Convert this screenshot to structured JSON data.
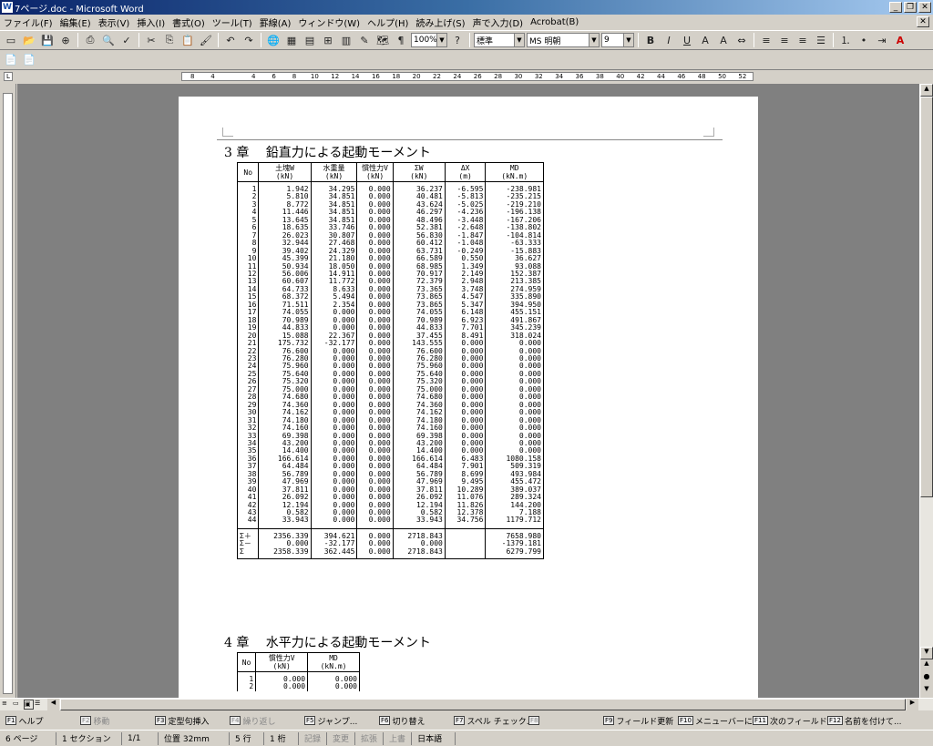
{
  "window": {
    "title": "7ページ.doc - Microsoft Word"
  },
  "menu": [
    "ファイル(F)",
    "編集(E)",
    "表示(V)",
    "挿入(I)",
    "書式(O)",
    "ツール(T)",
    "罫線(A)",
    "ウィンドウ(W)",
    "ヘルプ(H)",
    "読み上げ(S)",
    "声で入力(D)",
    "Acrobat(B)"
  ],
  "toolbar": {
    "zoom": "100%",
    "style": "標準",
    "font": "MS 明朝",
    "size": "9"
  },
  "ruler": [
    "8",
    "4",
    "",
    "4",
    "6",
    "8",
    "10",
    "12",
    "14",
    "16",
    "18",
    "20",
    "22",
    "24",
    "26",
    "28",
    "30",
    "32",
    "34",
    "36",
    "38",
    "40",
    "42",
    "44",
    "46",
    "48",
    "50",
    "52"
  ],
  "doc": {
    "heading3": "3 章　 鉛直力による起動モーメント",
    "heading4": "4 章　 水平力による起動モーメント",
    "table3": {
      "headers": [
        [
          "No",
          ""
        ],
        [
          "土塊W",
          "(kN)"
        ],
        [
          "水重量",
          "(kN)"
        ],
        [
          "慣性力V",
          "(kN)"
        ],
        [
          "ΣW",
          "(kN)"
        ],
        [
          "ΔX",
          "(m)"
        ],
        [
          "MD",
          "(kN.m)"
        ]
      ],
      "rows": [
        [
          "1",
          "1.942",
          "34.295",
          "0.000",
          "36.237",
          "-6.595",
          "-238.981"
        ],
        [
          "2",
          "5.810",
          "34.851",
          "0.000",
          "40.481",
          "-5.813",
          "-235.215"
        ],
        [
          "3",
          "8.772",
          "34.851",
          "0.000",
          "43.624",
          "-5.025",
          "-219.210"
        ],
        [
          "4",
          "11.446",
          "34.851",
          "0.000",
          "46.297",
          "-4.236",
          "-196.138"
        ],
        [
          "5",
          "13.645",
          "34.851",
          "0.000",
          "48.496",
          "-3.448",
          "-167.206"
        ],
        [
          "6",
          "18.635",
          "33.746",
          "0.000",
          "52.381",
          "-2.648",
          "-138.802"
        ],
        [
          "7",
          "26.023",
          "30.807",
          "0.000",
          "56.830",
          "-1.847",
          "-104.814"
        ],
        [
          "8",
          "32.944",
          "27.468",
          "0.000",
          "60.412",
          "-1.048",
          "-63.333"
        ],
        [
          "9",
          "39.402",
          "24.329",
          "0.000",
          "63.731",
          "-0.249",
          "-15.883"
        ],
        [
          "10",
          "45.399",
          "21.180",
          "0.000",
          "66.589",
          "0.550",
          "36.627"
        ],
        [
          "11",
          "50.934",
          "18.050",
          "0.000",
          "68.985",
          "1.349",
          "93.088"
        ],
        [
          "12",
          "56.006",
          "14.911",
          "0.000",
          "70.917",
          "2.149",
          "152.387"
        ],
        [
          "13",
          "60.607",
          "11.772",
          "0.000",
          "72.379",
          "2.948",
          "213.385"
        ],
        [
          "14",
          "64.733",
          "8.633",
          "0.000",
          "73.365",
          "3.748",
          "274.959"
        ],
        [
          "15",
          "68.372",
          "5.494",
          "0.000",
          "73.865",
          "4.547",
          "335.890"
        ],
        [
          "16",
          "71.511",
          "2.354",
          "0.000",
          "73.865",
          "5.347",
          "394.950"
        ],
        [
          "17",
          "74.055",
          "0.000",
          "0.000",
          "74.055",
          "6.148",
          "455.151"
        ],
        [
          "18",
          "70.989",
          "0.000",
          "0.000",
          "70.989",
          "6.923",
          "491.867"
        ],
        [
          "19",
          "44.833",
          "0.000",
          "0.000",
          "44.833",
          "7.701",
          "345.239"
        ],
        [
          "20",
          "15.088",
          "22.367",
          "0.000",
          "37.455",
          "8.491",
          "318.024"
        ],
        [
          "21",
          "175.732",
          "-32.177",
          "0.000",
          "143.555",
          "0.000",
          "0.000"
        ],
        [
          "22",
          "76.600",
          "0.000",
          "0.000",
          "76.600",
          "0.000",
          "0.000"
        ],
        [
          "23",
          "76.280",
          "0.000",
          "0.000",
          "76.280",
          "0.000",
          "0.000"
        ],
        [
          "24",
          "75.960",
          "0.000",
          "0.000",
          "75.960",
          "0.000",
          "0.000"
        ],
        [
          "25",
          "75.640",
          "0.000",
          "0.000",
          "75.640",
          "0.000",
          "0.000"
        ],
        [
          "26",
          "75.320",
          "0.000",
          "0.000",
          "75.320",
          "0.000",
          "0.000"
        ],
        [
          "27",
          "75.000",
          "0.000",
          "0.000",
          "75.000",
          "0.000",
          "0.000"
        ],
        [
          "28",
          "74.680",
          "0.000",
          "0.000",
          "74.680",
          "0.000",
          "0.000"
        ],
        [
          "29",
          "74.360",
          "0.000",
          "0.000",
          "74.360",
          "0.000",
          "0.000"
        ],
        [
          "30",
          "74.162",
          "0.000",
          "0.000",
          "74.162",
          "0.000",
          "0.000"
        ],
        [
          "31",
          "74.180",
          "0.000",
          "0.000",
          "74.180",
          "0.000",
          "0.000"
        ],
        [
          "32",
          "74.160",
          "0.000",
          "0.000",
          "74.160",
          "0.000",
          "0.000"
        ],
        [
          "33",
          "69.398",
          "0.000",
          "0.000",
          "69.398",
          "0.000",
          "0.000"
        ],
        [
          "34",
          "43.200",
          "0.000",
          "0.000",
          "43.200",
          "0.000",
          "0.000"
        ],
        [
          "35",
          "14.400",
          "0.000",
          "0.000",
          "14.400",
          "0.000",
          "0.000"
        ],
        [
          "36",
          "166.614",
          "0.000",
          "0.000",
          "166.614",
          "6.483",
          "1080.158"
        ],
        [
          "37",
          "64.484",
          "0.000",
          "0.000",
          "64.484",
          "7.901",
          "509.319"
        ],
        [
          "38",
          "56.789",
          "0.000",
          "0.000",
          "56.789",
          "8.699",
          "493.984"
        ],
        [
          "39",
          "47.969",
          "0.000",
          "0.000",
          "47.969",
          "9.495",
          "455.472"
        ],
        [
          "40",
          "37.811",
          "0.000",
          "0.000",
          "37.811",
          "10.289",
          "389.037"
        ],
        [
          "41",
          "26.092",
          "0.000",
          "0.000",
          "26.092",
          "11.076",
          "289.324"
        ],
        [
          "42",
          "12.194",
          "0.000",
          "0.000",
          "12.194",
          "11.826",
          "144.200"
        ],
        [
          "43",
          "0.582",
          "0.000",
          "0.000",
          "0.582",
          "12.378",
          "7.188"
        ],
        [
          "44",
          "33.943",
          "0.000",
          "0.000",
          "33.943",
          "34.756",
          "1179.712"
        ]
      ],
      "sums": [
        [
          "Σ＋",
          "2356.339",
          "394.621",
          "0.000",
          "2718.843",
          "",
          "7658.980"
        ],
        [
          "Σ－",
          "0.000",
          "-32.177",
          "0.000",
          "0.000",
          "",
          "-1379.181"
        ],
        [
          "Σ",
          "2358.339",
          "362.445",
          "0.000",
          "2718.843",
          "",
          "6279.799"
        ]
      ]
    },
    "table4": {
      "headers": [
        [
          "No",
          ""
        ],
        [
          "慣性力V",
          "(kN)"
        ],
        [
          "MD",
          "(kN.m)"
        ]
      ],
      "rows": [
        [
          "1",
          "0.000",
          "0.000"
        ],
        [
          "2",
          "0.000",
          "0.000"
        ]
      ]
    }
  },
  "fkeys": [
    {
      "k": "F1",
      "label": "ヘルプ",
      "enabled": true
    },
    {
      "k": "F2",
      "label": "移動",
      "enabled": false
    },
    {
      "k": "F3",
      "label": "定型句挿入",
      "enabled": true
    },
    {
      "k": "F4",
      "label": "繰り返し",
      "enabled": false
    },
    {
      "k": "F5",
      "label": "ジャンプ...",
      "enabled": true
    },
    {
      "k": "F6",
      "label": "切り替え",
      "enabled": true
    },
    {
      "k": "F7",
      "label": "スペル チェック...",
      "enabled": true
    },
    {
      "k": "F8",
      "label": "",
      "enabled": false
    },
    {
      "k": "F9",
      "label": "フィールド更新",
      "enabled": true
    },
    {
      "k": "F10",
      "label": "メニューバーに...",
      "enabled": true
    },
    {
      "k": "F11",
      "label": "次のフィールド",
      "enabled": true
    },
    {
      "k": "F12",
      "label": "名前を付けて...",
      "enabled": true
    }
  ],
  "status": {
    "page": "6 ページ",
    "section": "1 セクション",
    "pageof": "1/1",
    "pos": "位置 32mm",
    "line": "5 行",
    "col": "1 桁",
    "rec": "記録",
    "trk": "変更",
    "ext": "拡張",
    "ovr": "上書",
    "lang": "日本語"
  }
}
